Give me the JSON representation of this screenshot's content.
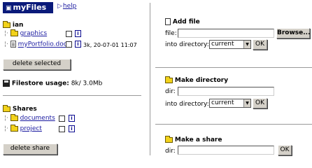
{
  "header": {
    "title": "myFiles",
    "help_label": "help"
  },
  "tree": {
    "root_label": "ian",
    "items": [
      {
        "label": "graphics",
        "type": "folder",
        "meta": ""
      },
      {
        "label": "myPortfolio.doc",
        "type": "file",
        "meta": "3k, 20-07-01 11:07"
      }
    ],
    "delete_selected_label": "delete selected",
    "filestore_label": "Filestore usage:",
    "filestore_value": "8k/ 3.0Mb",
    "info_glyph": "i"
  },
  "shares": {
    "title": "Shares",
    "items": [
      {
        "label": "documents"
      },
      {
        "label": "project"
      }
    ],
    "delete_share_label": "delete share"
  },
  "add_file": {
    "title": "Add file",
    "file_label": "file:",
    "browse_label": "Browse...",
    "dir_label": "into directory:",
    "dir_value": "current",
    "ok_label": "OK"
  },
  "make_directory": {
    "title": "Make directory",
    "dir_label": "dir:",
    "into_label": "into directory:",
    "into_value": "current",
    "ok_label": "OK"
  },
  "make_share": {
    "title": "Make a share",
    "dir_label": "dir:",
    "ok_label": "OK"
  }
}
